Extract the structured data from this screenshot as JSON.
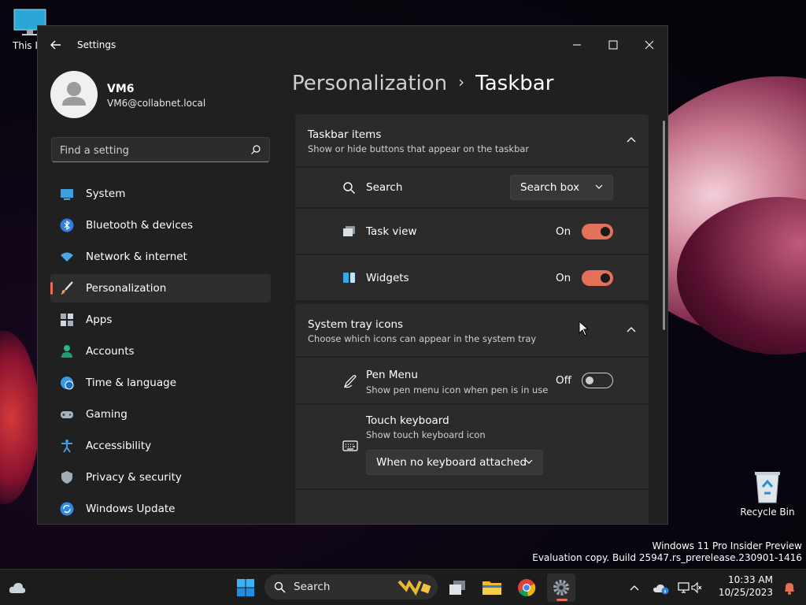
{
  "desktop": {
    "this_pc_label": "This PC",
    "recycle_bin_label": "Recycle Bin",
    "watermark_line1": "Windows 11 Pro Insider Preview",
    "watermark_line2": "Evaluation copy. Build 25947.rs_prerelease.230901-1416"
  },
  "window": {
    "title": "Settings"
  },
  "profile": {
    "name": "VM6",
    "email": "VM6@collabnet.local"
  },
  "search": {
    "placeholder": "Find a setting"
  },
  "nav": {
    "items": [
      {
        "label": "System",
        "icon": "system-icon"
      },
      {
        "label": "Bluetooth & devices",
        "icon": "bluetooth-icon"
      },
      {
        "label": "Network & internet",
        "icon": "wifi-icon"
      },
      {
        "label": "Personalization",
        "icon": "brush-icon",
        "active": true
      },
      {
        "label": "Apps",
        "icon": "apps-icon"
      },
      {
        "label": "Accounts",
        "icon": "accounts-icon"
      },
      {
        "label": "Time & language",
        "icon": "globe-icon"
      },
      {
        "label": "Gaming",
        "icon": "gamepad-icon"
      },
      {
        "label": "Accessibility",
        "icon": "accessibility-icon"
      },
      {
        "label": "Privacy & security",
        "icon": "shield-icon"
      },
      {
        "label": "Windows Update",
        "icon": "update-icon"
      }
    ]
  },
  "breadcrumb": {
    "parent": "Personalization",
    "separator": "›",
    "current": "Taskbar"
  },
  "taskbar_items": {
    "title": "Taskbar items",
    "subtitle": "Show or hide buttons that appear on the taskbar",
    "search": {
      "label": "Search",
      "value": "Search box"
    },
    "task_view": {
      "label": "Task view",
      "state": "On"
    },
    "widgets": {
      "label": "Widgets",
      "state": "On"
    }
  },
  "tray_icons": {
    "title": "System tray icons",
    "subtitle": "Choose which icons can appear in the system tray",
    "pen_menu": {
      "label": "Pen Menu",
      "subtitle": "Show pen menu icon when pen is in use",
      "state": "Off"
    },
    "touch_keyboard": {
      "label": "Touch keyboard",
      "subtitle": "Show touch keyboard icon",
      "value": "When no keyboard attached"
    }
  },
  "taskbar": {
    "search_label": "Search",
    "time": "10:33 AM",
    "date": "10/25/2023"
  },
  "colors": {
    "accent": "#e37058",
    "window_bg": "#202020",
    "card_bg": "#2b2b2b"
  }
}
